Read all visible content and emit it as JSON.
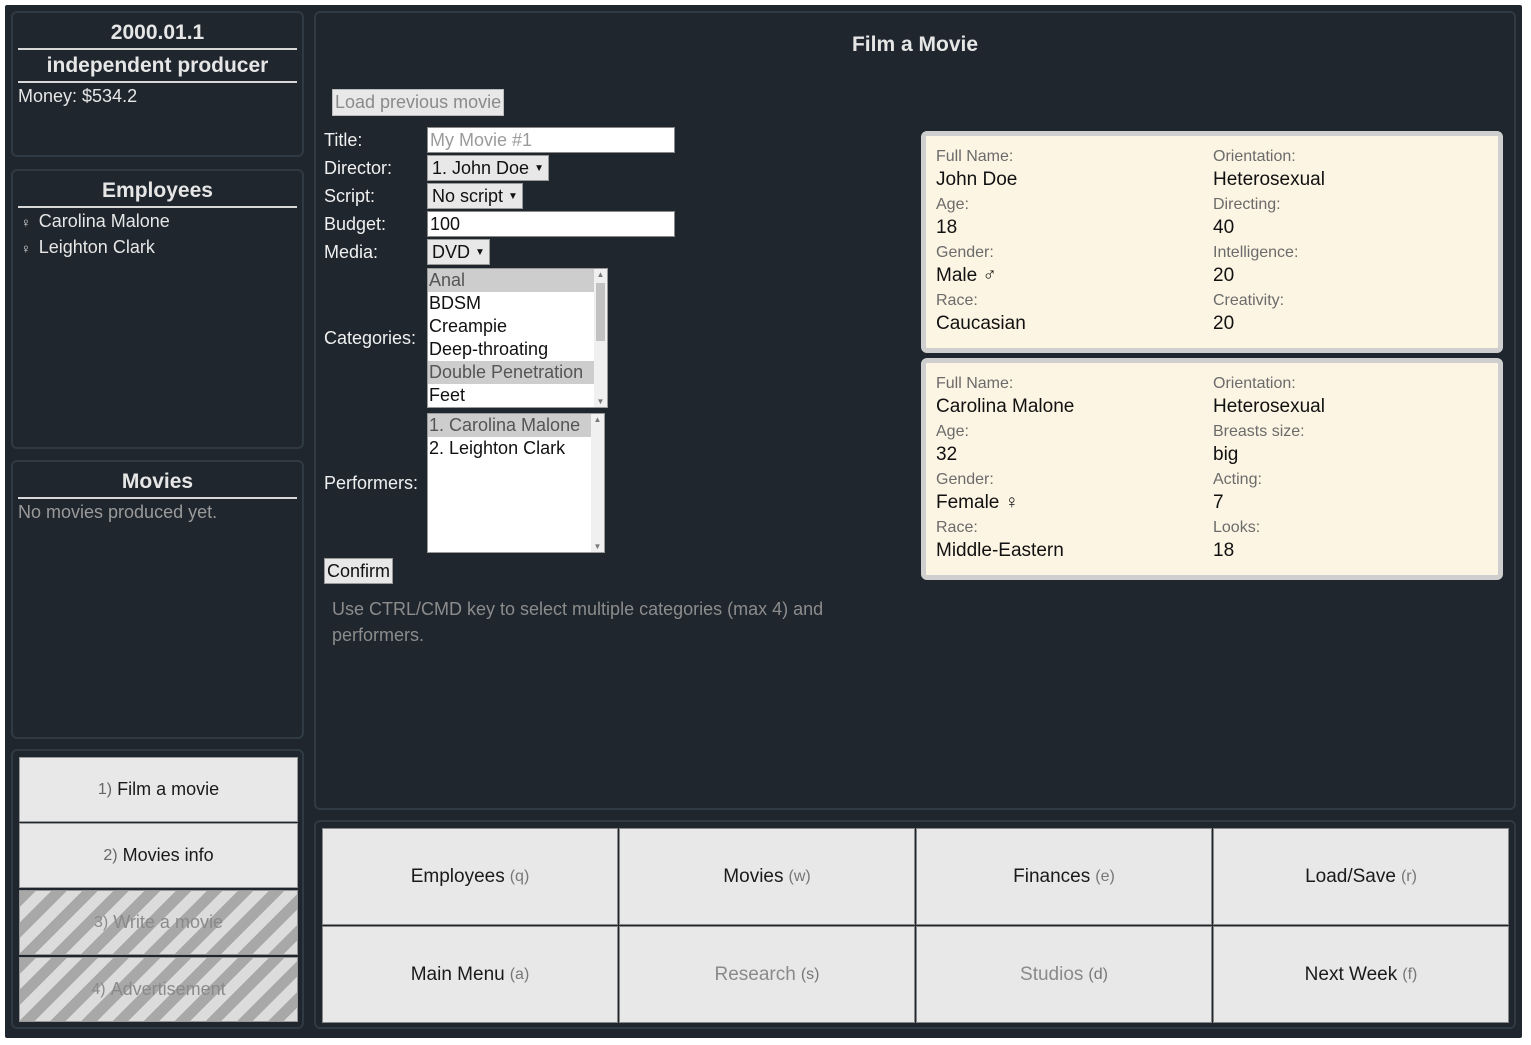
{
  "status": {
    "date": "2000.01.1",
    "role": "independent producer",
    "money": "Money: $534.2"
  },
  "employees": {
    "title": "Employees",
    "items": [
      {
        "symbol": "♀",
        "name": "Carolina Malone"
      },
      {
        "symbol": "♀",
        "name": "Leighton Clark"
      }
    ]
  },
  "movies": {
    "title": "Movies",
    "empty": "No movies produced yet."
  },
  "actions": [
    {
      "key": "1)",
      "label": "Film a movie",
      "enabled": true
    },
    {
      "key": "2)",
      "label": "Movies info",
      "enabled": true
    },
    {
      "key": "3)",
      "label": "Write a movie",
      "enabled": false
    },
    {
      "key": "4)",
      "label": "Advertisement",
      "enabled": false
    }
  ],
  "film": {
    "heading": "Film a Movie",
    "load_button": "Load previous movie",
    "labels": {
      "title": "Title:",
      "director": "Director:",
      "script": "Script:",
      "budget": "Budget:",
      "media": "Media:",
      "categories": "Categories:",
      "performers": "Performers:"
    },
    "title_placeholder": "My Movie #1",
    "director_value": "1. John Doe",
    "script_value": "No script",
    "budget_value": "100",
    "media_value": "DVD",
    "categories": [
      {
        "label": "Anal",
        "selected": true
      },
      {
        "label": "BDSM",
        "selected": false
      },
      {
        "label": "Creampie",
        "selected": false
      },
      {
        "label": "Deep-throating",
        "selected": false
      },
      {
        "label": "Double Penetration",
        "selected": true
      },
      {
        "label": "Feet",
        "selected": false
      }
    ],
    "performers": [
      {
        "label": "1. Carolina Malone",
        "selected": true
      },
      {
        "label": "2. Leighton Clark",
        "selected": false
      }
    ],
    "confirm": "Confirm",
    "hint": "Use CTRL/CMD key to select multiple categories (max 4) and performers."
  },
  "cards": [
    {
      "left": [
        {
          "label": "Full Name:",
          "value": "John Doe"
        },
        {
          "label": "Age:",
          "value": "18"
        },
        {
          "label": "Gender:",
          "value": "Male ♂"
        },
        {
          "label": "Race:",
          "value": "Caucasian"
        }
      ],
      "right": [
        {
          "label": "Orientation:",
          "value": "Heterosexual"
        },
        {
          "label": "Directing:",
          "value": "40"
        },
        {
          "label": "Intelligence:",
          "value": "20"
        },
        {
          "label": "Creativity:",
          "value": "20"
        }
      ]
    },
    {
      "left": [
        {
          "label": "Full Name:",
          "value": "Carolina Malone"
        },
        {
          "label": "Age:",
          "value": "32"
        },
        {
          "label": "Gender:",
          "value": "Female ♀"
        },
        {
          "label": "Race:",
          "value": "Middle-Eastern"
        }
      ],
      "right": [
        {
          "label": "Orientation:",
          "value": "Heterosexual"
        },
        {
          "label": "Breasts size:",
          "value": "big"
        },
        {
          "label": "Acting:",
          "value": "7"
        },
        {
          "label": "Looks:",
          "value": "18"
        }
      ]
    }
  ],
  "nav": [
    {
      "label": "Employees",
      "key": "(q)",
      "enabled": true
    },
    {
      "label": "Movies",
      "key": "(w)",
      "enabled": true
    },
    {
      "label": "Finances",
      "key": "(e)",
      "enabled": true
    },
    {
      "label": "Load/Save",
      "key": "(r)",
      "enabled": true
    },
    {
      "label": "Main Menu",
      "key": "(a)",
      "enabled": true
    },
    {
      "label": "Research",
      "key": "(s)",
      "enabled": false
    },
    {
      "label": "Studios",
      "key": "(d)",
      "enabled": false
    },
    {
      "label": "Next Week",
      "key": "(f)",
      "enabled": true
    }
  ]
}
